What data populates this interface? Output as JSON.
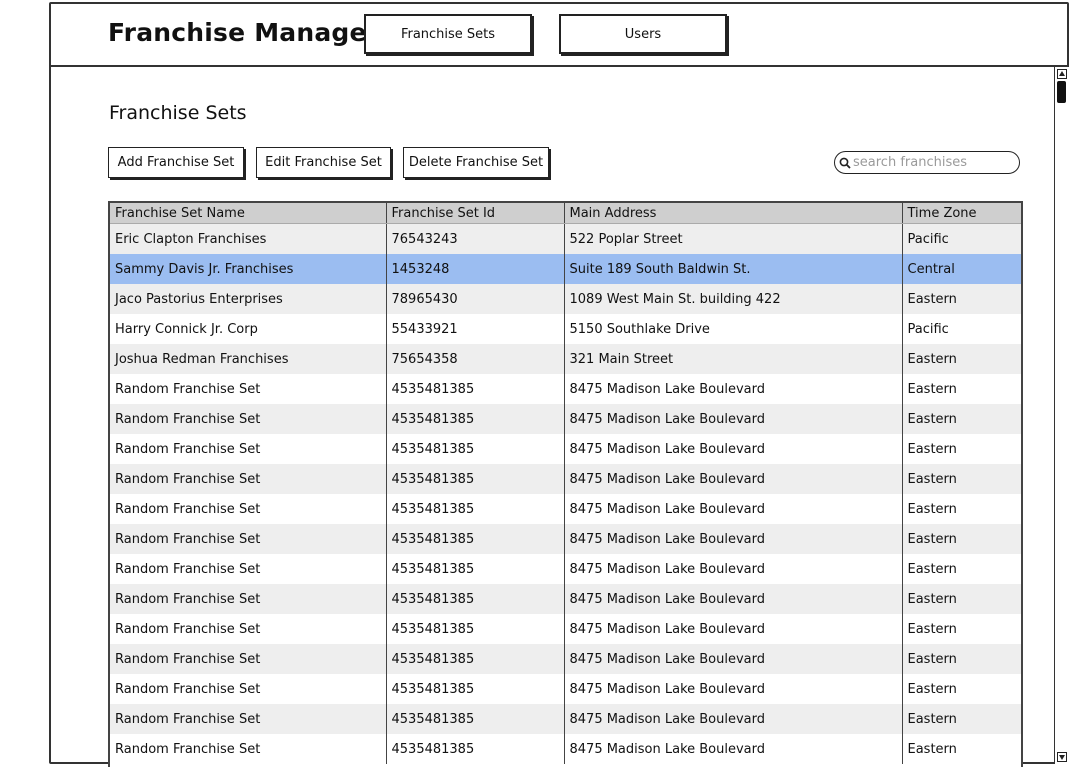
{
  "header": {
    "app_title": "Franchise Manager",
    "nav": [
      {
        "label": "Franchise Sets"
      },
      {
        "label": "Users"
      }
    ]
  },
  "main": {
    "page_title": "Franchise Sets",
    "actions": {
      "add_label": "Add Franchise Set",
      "edit_label": "Edit Franchise Set",
      "delete_label": "Delete Franchise Set"
    },
    "search": {
      "placeholder": "search franchises",
      "value": ""
    }
  },
  "table": {
    "columns": [
      "Franchise Set Name",
      "Franchise Set Id",
      "Main Address",
      "Time Zone"
    ],
    "selected_row": 1,
    "rows": [
      [
        "Eric Clapton Franchises",
        "76543243",
        "522 Poplar Street",
        "Pacific"
      ],
      [
        "Sammy Davis Jr. Franchises",
        "1453248",
        "Suite 189 South Baldwin St.",
        "Central"
      ],
      [
        "Jaco Pastorius Enterprises",
        "78965430",
        "1089 West Main St. building 422",
        "Eastern"
      ],
      [
        "Harry Connick Jr. Corp",
        "55433921",
        "5150 Southlake Drive",
        "Pacific"
      ],
      [
        "Joshua Redman Franchises",
        "75654358",
        "321 Main Street",
        "Eastern"
      ],
      [
        "Random Franchise Set",
        "4535481385",
        "8475 Madison Lake Boulevard",
        "Eastern"
      ],
      [
        "Random Franchise Set",
        "4535481385",
        "8475 Madison Lake Boulevard",
        "Eastern"
      ],
      [
        "Random Franchise Set",
        "4535481385",
        "8475 Madison Lake Boulevard",
        "Eastern"
      ],
      [
        "Random Franchise Set",
        "4535481385",
        "8475 Madison Lake Boulevard",
        "Eastern"
      ],
      [
        "Random Franchise Set",
        "4535481385",
        "8475 Madison Lake Boulevard",
        "Eastern"
      ],
      [
        "Random Franchise Set",
        "4535481385",
        "8475 Madison Lake Boulevard",
        "Eastern"
      ],
      [
        "Random Franchise Set",
        "4535481385",
        "8475 Madison Lake Boulevard",
        "Eastern"
      ],
      [
        "Random Franchise Set",
        "4535481385",
        "8475 Madison Lake Boulevard",
        "Eastern"
      ],
      [
        "Random Franchise Set",
        "4535481385",
        "8475 Madison Lake Boulevard",
        "Eastern"
      ],
      [
        "Random Franchise Set",
        "4535481385",
        "8475 Madison Lake Boulevard",
        "Eastern"
      ],
      [
        "Random Franchise Set",
        "4535481385",
        "8475 Madison Lake Boulevard",
        "Eastern"
      ],
      [
        "Random Franchise Set",
        "4535481385",
        "8475 Madison Lake Boulevard",
        "Eastern"
      ],
      [
        "Random Franchise Set",
        "4535481385",
        "8475 Madison Lake Boulevard",
        "Eastern"
      ]
    ]
  },
  "colors": {
    "selected_row": "#9bbdf1",
    "header_bg": "#cfcfcf",
    "row_alt": "#eeeeee"
  },
  "icons": {
    "search": "search-icon",
    "scroll_up": "arrow-up-icon",
    "scroll_down": "arrow-down-icon"
  }
}
